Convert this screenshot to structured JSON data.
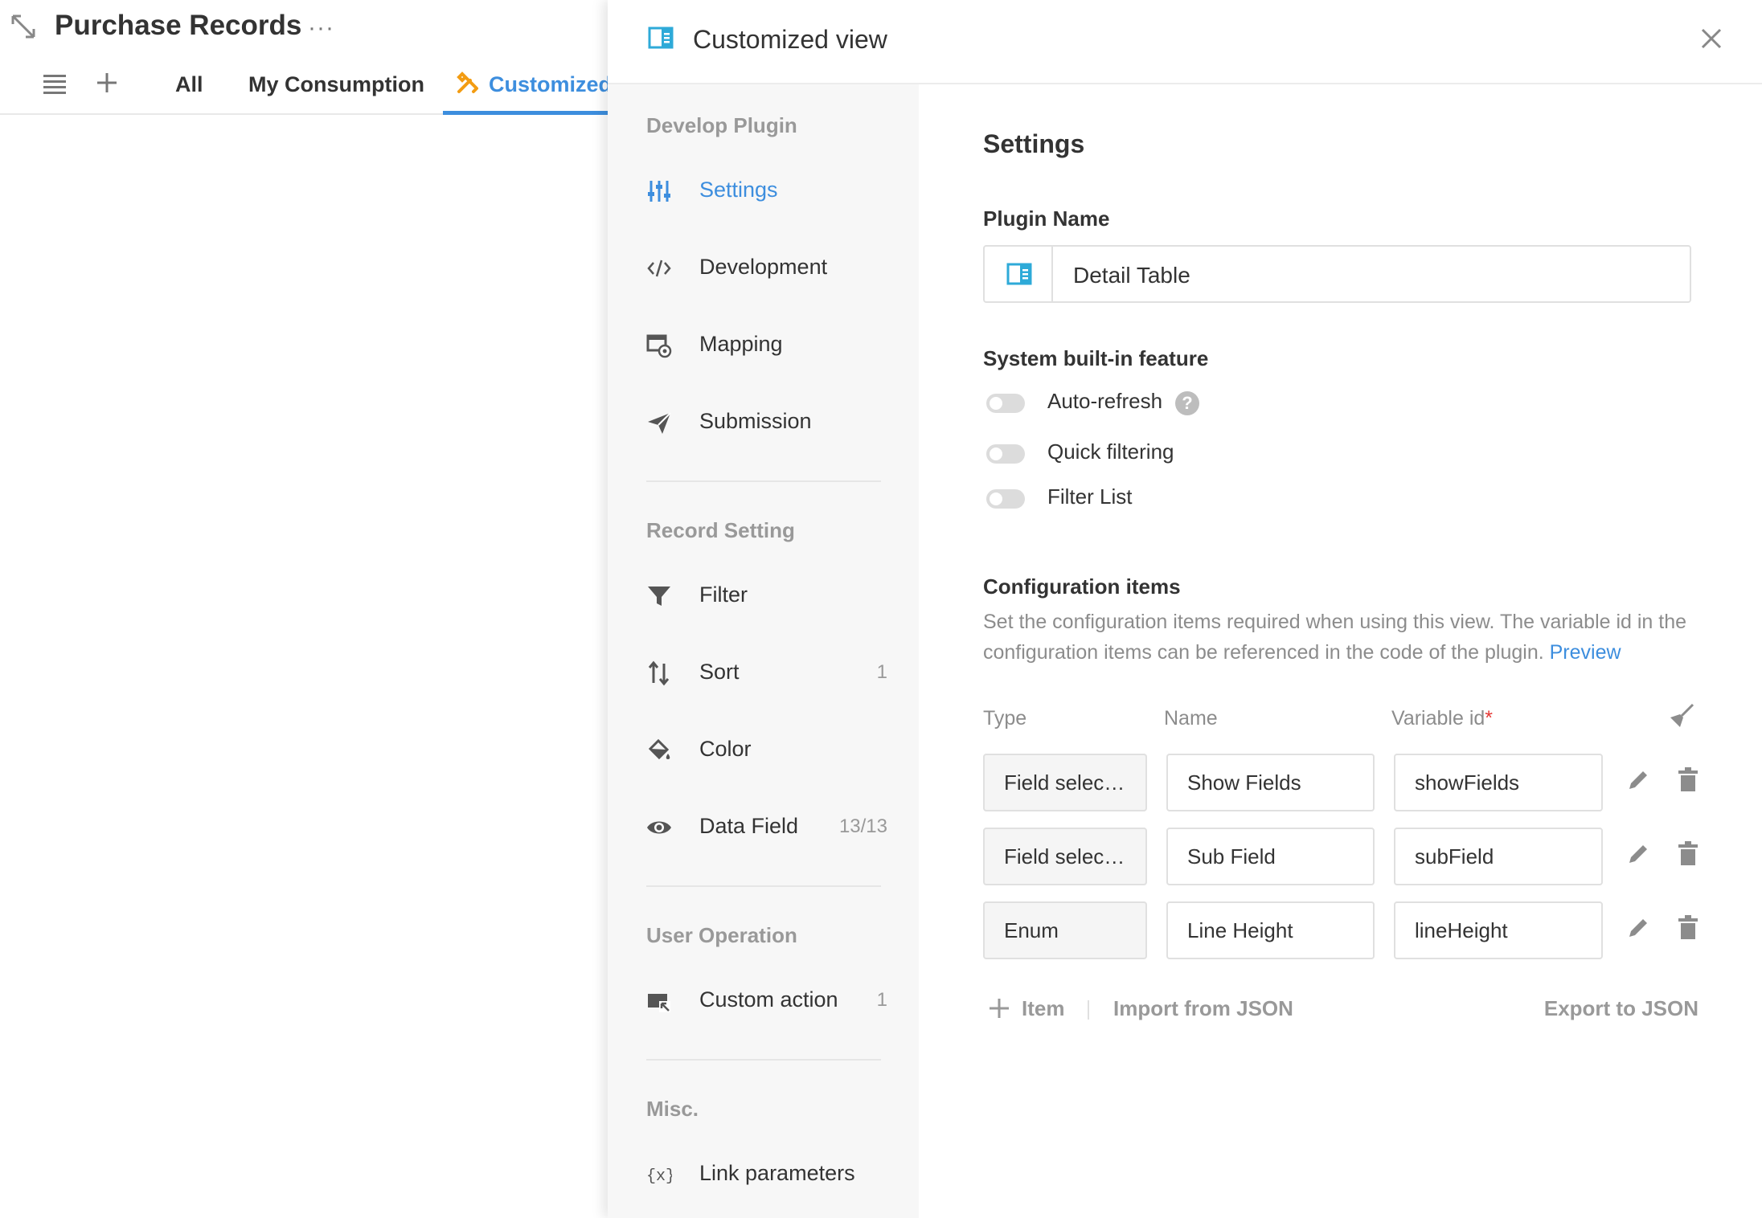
{
  "page": {
    "title": "Purchase Records",
    "more": "···",
    "tabs": [
      {
        "label": "All"
      },
      {
        "label": "My Consumption"
      },
      {
        "label": "Customized"
      }
    ]
  },
  "drawer": {
    "title": "Customized view",
    "nav": {
      "sections": [
        {
          "title": "Develop Plugin"
        },
        {
          "title": "Record Setting"
        },
        {
          "title": "User Operation"
        },
        {
          "title": "Misc."
        }
      ],
      "items": [
        {
          "label": "Settings",
          "icon": "sliders-icon",
          "active": true
        },
        {
          "label": "Development",
          "icon": "code-icon"
        },
        {
          "label": "Mapping",
          "icon": "mapping-icon"
        },
        {
          "label": "Submission",
          "icon": "send-icon"
        },
        {
          "label": "Filter",
          "icon": "filter-icon"
        },
        {
          "label": "Sort",
          "icon": "sort-icon",
          "count": "1"
        },
        {
          "label": "Color",
          "icon": "paint-bucket-icon"
        },
        {
          "label": "Data Field",
          "icon": "eye-icon",
          "count": "13/13"
        },
        {
          "label": "Custom action",
          "icon": "cursor-action-icon",
          "count": "1"
        },
        {
          "label": "Link parameters",
          "icon": "variable-icon"
        }
      ]
    },
    "settings": {
      "heading": "Settings",
      "plugin_name_label": "Plugin Name",
      "plugin_name_value": "Detail Table",
      "builtin_label": "System built-in feature",
      "features": [
        {
          "label": "Auto-refresh",
          "enabled": false,
          "help": "?"
        },
        {
          "label": "Quick filtering",
          "enabled": false
        },
        {
          "label": "Filter List",
          "enabled": false
        }
      ],
      "config_label": "Configuration items",
      "config_desc": "Set the configuration items required when using this view. The variable id in the configuration items can be referenced in the code of the plugin.",
      "preview_link": "Preview",
      "columns": {
        "type": "Type",
        "name": "Name",
        "variable_id": "Variable id",
        "required_mark": "*"
      },
      "rows": [
        {
          "type": "Field selec…",
          "name": "Show Fields",
          "variable_id": "showFields"
        },
        {
          "type": "Field selec…",
          "name": "Sub Field",
          "variable_id": "subField"
        },
        {
          "type": "Enum",
          "name": "Line Height",
          "variable_id": "lineHeight"
        }
      ],
      "add_item": "Item",
      "import_json": "Import from JSON",
      "export_json": "Export to JSON"
    }
  },
  "colors": {
    "accent": "#3d8ede",
    "wrench": "#f39c12",
    "teal_icon": "#2eaad8",
    "muted": "#999999"
  }
}
